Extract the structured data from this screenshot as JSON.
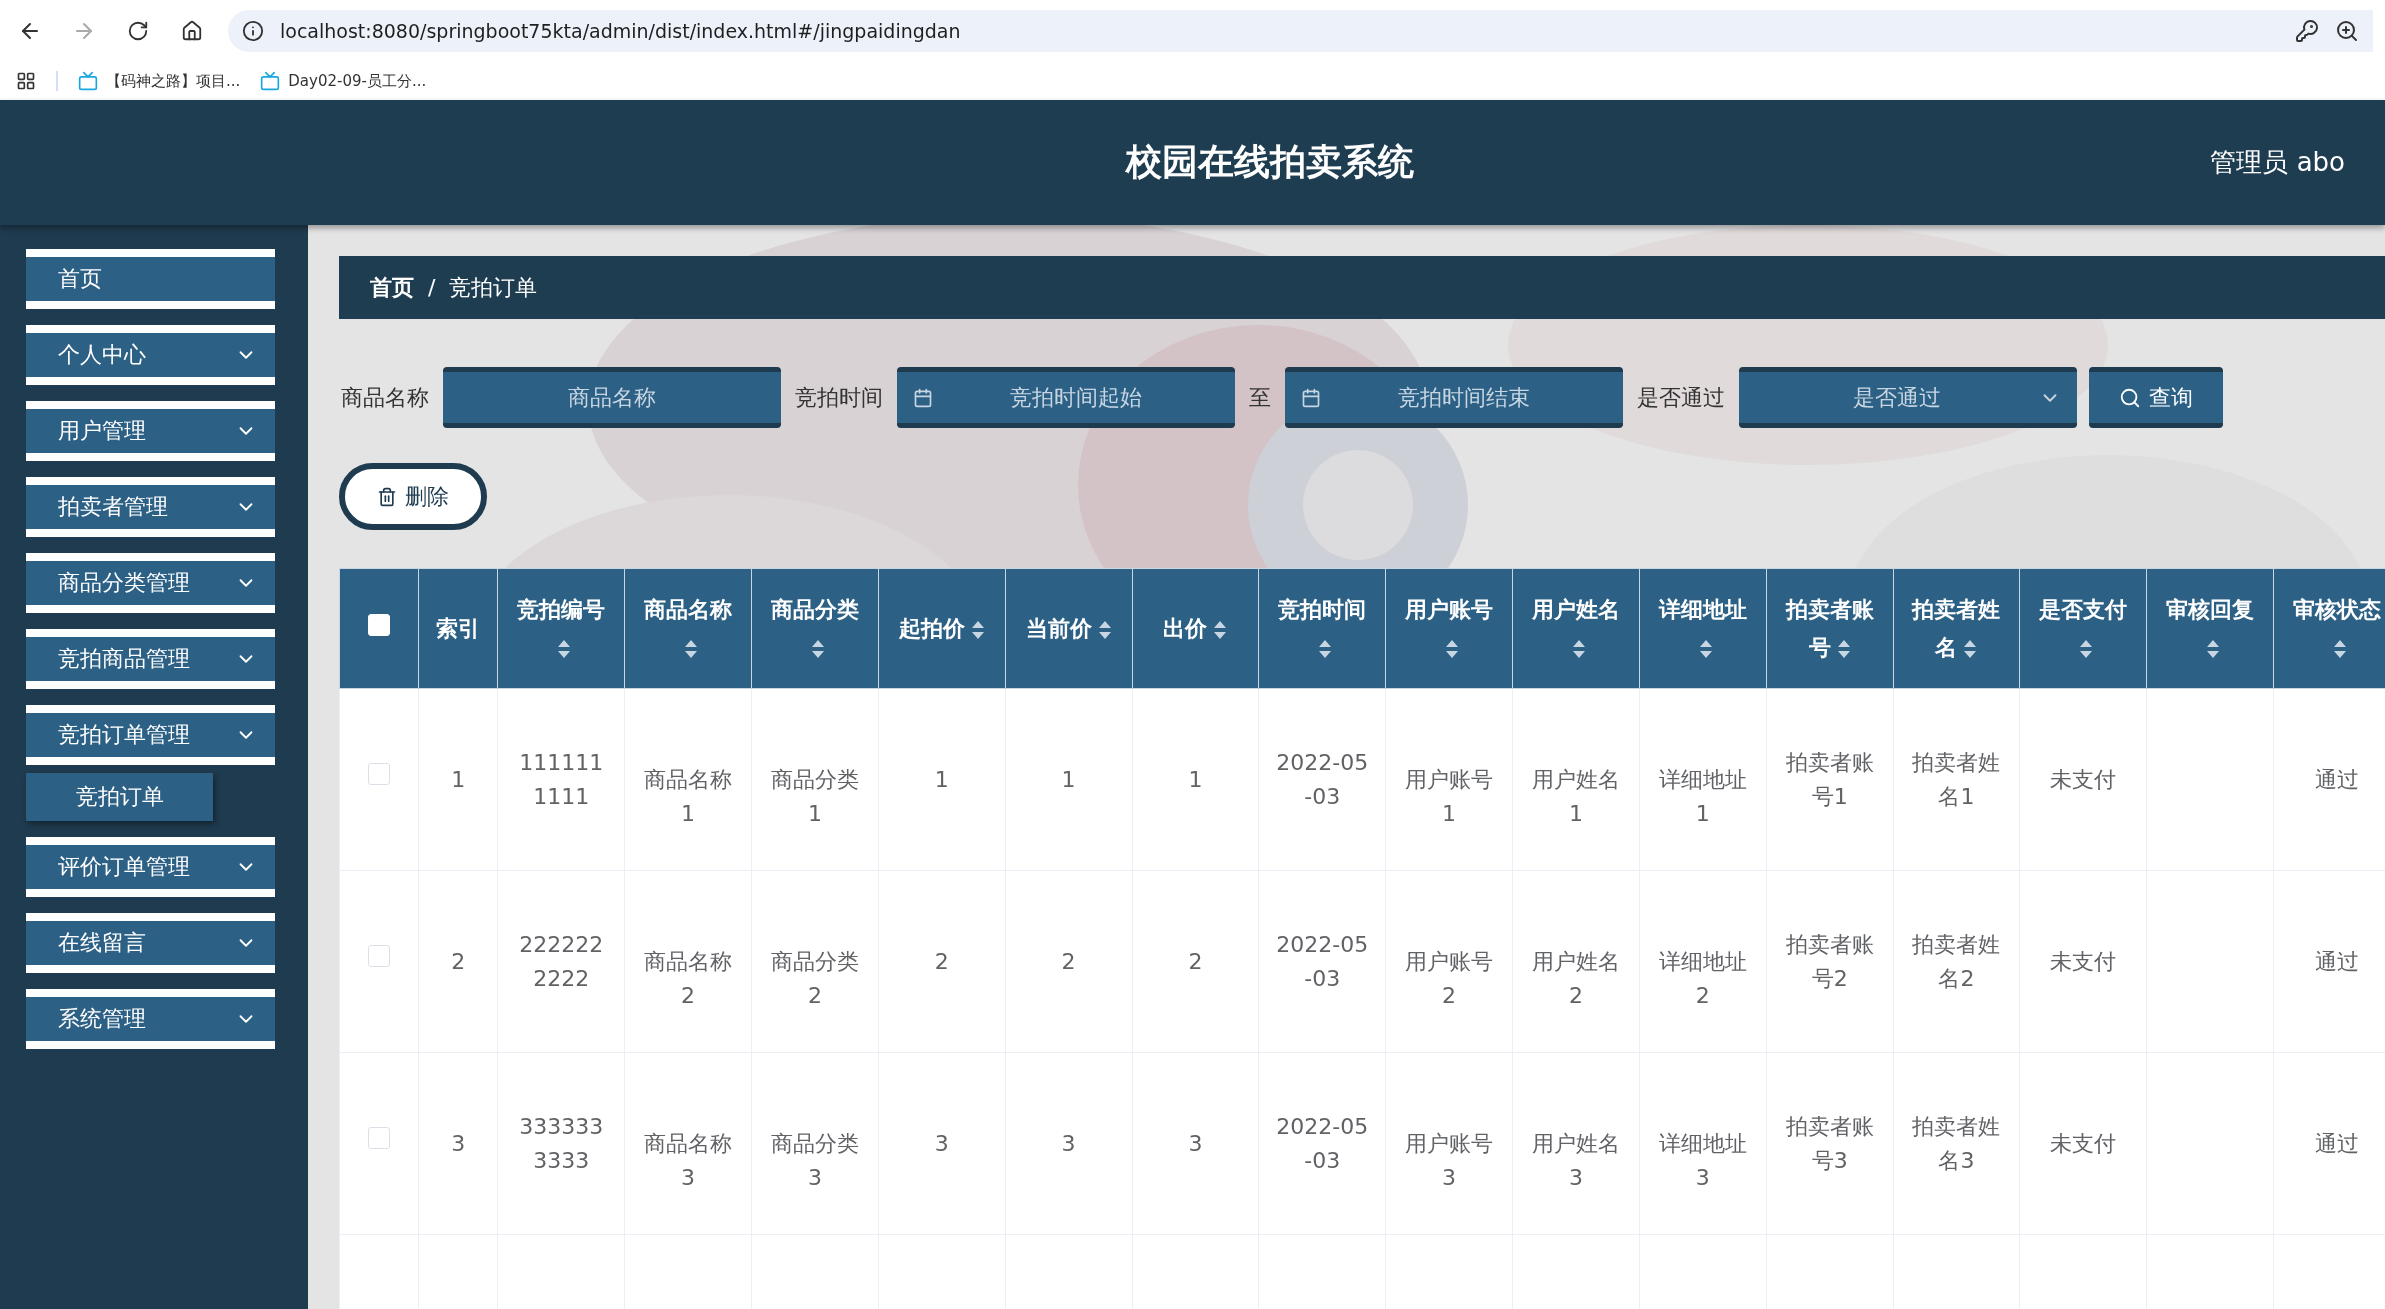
{
  "browser": {
    "url": "localhost:8080/springboot75kta/admin/dist/index.html#/jingpaidingdan",
    "bookmarks": [
      {
        "label": "【码神之路】项目..."
      },
      {
        "label": "Day02-09-员工分..."
      }
    ]
  },
  "header": {
    "title": "校园在线拍卖系统",
    "user": "管理员 abo"
  },
  "sidebar": {
    "items": [
      {
        "label": "首页",
        "kind": "link"
      },
      {
        "label": "个人中心",
        "kind": "menu"
      },
      {
        "label": "用户管理",
        "kind": "menu"
      },
      {
        "label": "拍卖者管理",
        "kind": "menu"
      },
      {
        "label": "商品分类管理",
        "kind": "menu"
      },
      {
        "label": "竞拍商品管理",
        "kind": "menu"
      },
      {
        "label": "竞拍订单管理",
        "kind": "menu",
        "children": [
          {
            "label": "竞拍订单"
          }
        ]
      },
      {
        "label": "评价订单管理",
        "kind": "menu"
      },
      {
        "label": "在线留言",
        "kind": "menu"
      },
      {
        "label": "系统管理",
        "kind": "menu"
      }
    ]
  },
  "breadcrumb": [
    "首页",
    "竞拍订单"
  ],
  "breadcrumb_separator": "/",
  "filters": {
    "name_label": "商品名称",
    "name_placeholder": "商品名称",
    "time_label": "竞拍时间",
    "time_start_placeholder": "竞拍时间起始",
    "time_sep": "至",
    "time_end_placeholder": "竞拍时间结束",
    "pass_label": "是否通过",
    "pass_placeholder": "是否通过",
    "search_button": "查询"
  },
  "delete_button": "删除",
  "table": {
    "select_all": {
      "checked": false
    },
    "columns": [
      {
        "label": "索引",
        "sortable": false
      },
      {
        "label": "竞拍编号",
        "sortable": true
      },
      {
        "label": "商品名称",
        "sortable": true
      },
      {
        "label": "商品分类",
        "sortable": true
      },
      {
        "label": "起拍价",
        "sortable": true
      },
      {
        "label": "当前价",
        "sortable": true
      },
      {
        "label": "出价",
        "sortable": true
      },
      {
        "label": "竞拍时间",
        "sortable": true
      },
      {
        "label": "用户账号",
        "sortable": true
      },
      {
        "label": "用户姓名",
        "sortable": true
      },
      {
        "label": "详细地址",
        "sortable": true
      },
      {
        "label": "拍卖者账号",
        "sortable": true
      },
      {
        "label": "拍卖者姓名",
        "sortable": true
      },
      {
        "label": "是否支付",
        "sortable": true
      },
      {
        "label": "审核回复",
        "sortable": true
      },
      {
        "label": "审核状态",
        "sortable": true
      }
    ],
    "rows": [
      {
        "checked": false,
        "cells": [
          "1",
          "1111111111",
          "商品名称1",
          "商品分类1",
          "1",
          "1",
          "1",
          "2022-05-03",
          "用户账号1",
          "用户姓名1",
          "详细地址1",
          "拍卖者账号1",
          "拍卖者姓名1",
          "未支付",
          null,
          "通过"
        ]
      },
      {
        "checked": false,
        "cells": [
          "2",
          "2222222222",
          "商品名称2",
          "商品分类2",
          "2",
          "2",
          "2",
          "2022-05-03",
          "用户账号2",
          "用户姓名2",
          "详细地址2",
          "拍卖者账号2",
          "拍卖者姓名2",
          "未支付",
          null,
          "通过"
        ]
      },
      {
        "checked": false,
        "cells": [
          "3",
          "3333333333",
          "商品名称3",
          "商品分类3",
          "3",
          "3",
          "3",
          "2022-05-03",
          "用户账号3",
          "用户姓名3",
          "详细地址3",
          "拍卖者账号3",
          "拍卖者姓名3",
          "未支付",
          null,
          "通过"
        ]
      }
    ]
  }
}
